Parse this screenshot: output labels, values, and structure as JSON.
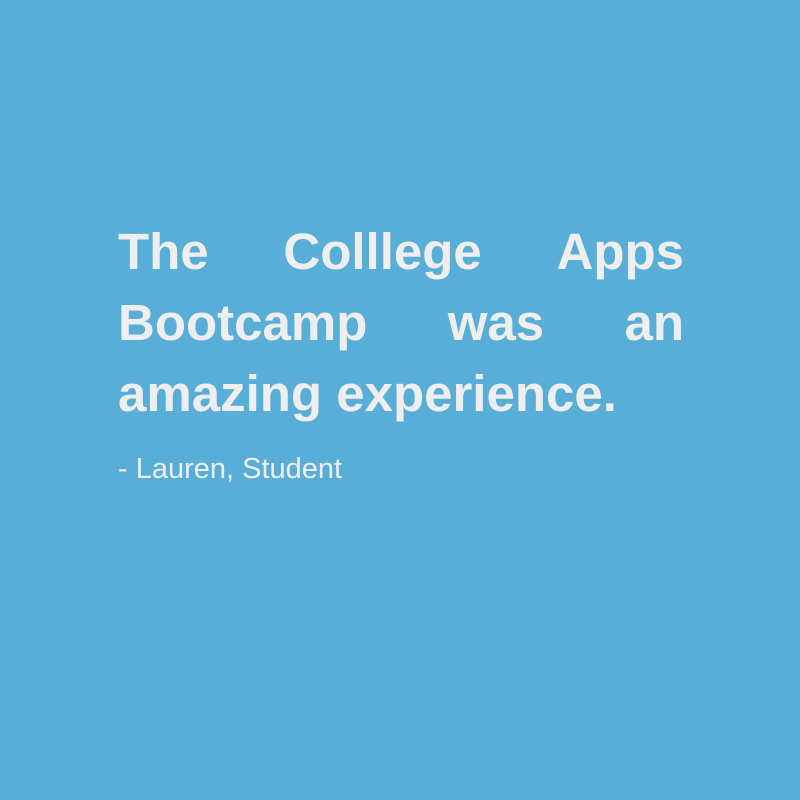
{
  "quote": {
    "lines": [
      [
        "The",
        "Colllege",
        "Apps"
      ],
      [
        "Bootcamp",
        "was",
        "an"
      ],
      [
        "amazing experience."
      ]
    ]
  },
  "attribution": "- Lauren, Student",
  "colors": {
    "background": "#58aed7",
    "text": "#eeeeee"
  }
}
